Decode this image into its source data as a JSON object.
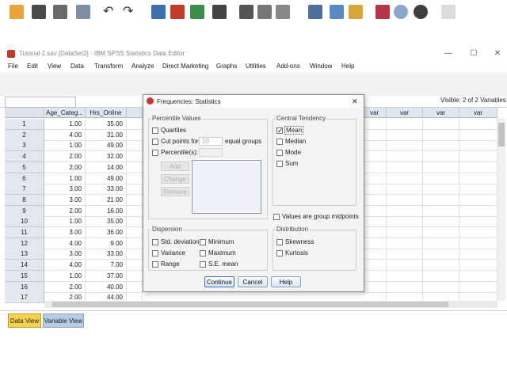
{
  "window": {
    "title": "Tutorial 2.sav [DataSet2] - IBM SPSS Statistics Data Editor",
    "minimize": "—",
    "maximize": "☐",
    "close": "✕"
  },
  "menu": [
    "File",
    "Edit",
    "View",
    "Data",
    "Transform",
    "Analyze",
    "Direct Marketing",
    "Graphs",
    "Utilities",
    "Add-ons",
    "Window",
    "Help"
  ],
  "visible_text": "Visible: 2 of 2 Variables",
  "columns": [
    "Age_Categ...",
    "Hrs_Online",
    "var",
    "var",
    "var",
    "var"
  ],
  "rows": [
    {
      "n": "1",
      "a": "1.00",
      "b": "35.00"
    },
    {
      "n": "2",
      "a": "4.00",
      "b": "31.00"
    },
    {
      "n": "3",
      "a": "1.00",
      "b": "49.00"
    },
    {
      "n": "4",
      "a": "2.00",
      "b": "32.00"
    },
    {
      "n": "5",
      "a": "2.00",
      "b": "14.00"
    },
    {
      "n": "6",
      "a": "1.00",
      "b": "49.00"
    },
    {
      "n": "7",
      "a": "3.00",
      "b": "33.00"
    },
    {
      "n": "8",
      "a": "3.00",
      "b": "21.00"
    },
    {
      "n": "9",
      "a": "2.00",
      "b": "16.00"
    },
    {
      "n": "10",
      "a": "1.00",
      "b": "35.00"
    },
    {
      "n": "11",
      "a": "3.00",
      "b": "36.00"
    },
    {
      "n": "12",
      "a": "4.00",
      "b": "9.00"
    },
    {
      "n": "13",
      "a": "3.00",
      "b": "33.00"
    },
    {
      "n": "14",
      "a": "4.00",
      "b": "7.00"
    },
    {
      "n": "15",
      "a": "1.00",
      "b": "37.00"
    },
    {
      "n": "16",
      "a": "2.00",
      "b": "40.00"
    },
    {
      "n": "17",
      "a": "2.00",
      "b": "44.00"
    }
  ],
  "tabs": {
    "data_view": "Data View",
    "variable_view": "Variable View"
  },
  "dialog": {
    "title": "Frequencies: Statistics",
    "close": "✕",
    "percentile": {
      "label": "Percentile Values",
      "quartiles": "Quartiles",
      "cut_points": "Cut points for:",
      "cut_value": "10",
      "equal_groups": "equal groups",
      "percentiles": "Percentile(s):",
      "add": "Add",
      "change": "Change",
      "remove": "Remove"
    },
    "central": {
      "label": "Central Tendency",
      "mean": "Mean",
      "median": "Median",
      "mode": "Mode",
      "sum": "Sum"
    },
    "midpoints": "Values are group midpoints",
    "dispersion": {
      "label": "Dispersion",
      "std": "Std. deviation",
      "variance": "Variance",
      "range": "Range",
      "minimum": "Minimum",
      "maximum": "Maximum",
      "se_mean": "S.E. mean"
    },
    "distribution": {
      "label": "Distribution",
      "skewness": "Skewness",
      "kurtosis": "Kurtosis"
    },
    "buttons": {
      "continue": "Continue",
      "cancel": "Cancel",
      "help": "Help"
    }
  }
}
